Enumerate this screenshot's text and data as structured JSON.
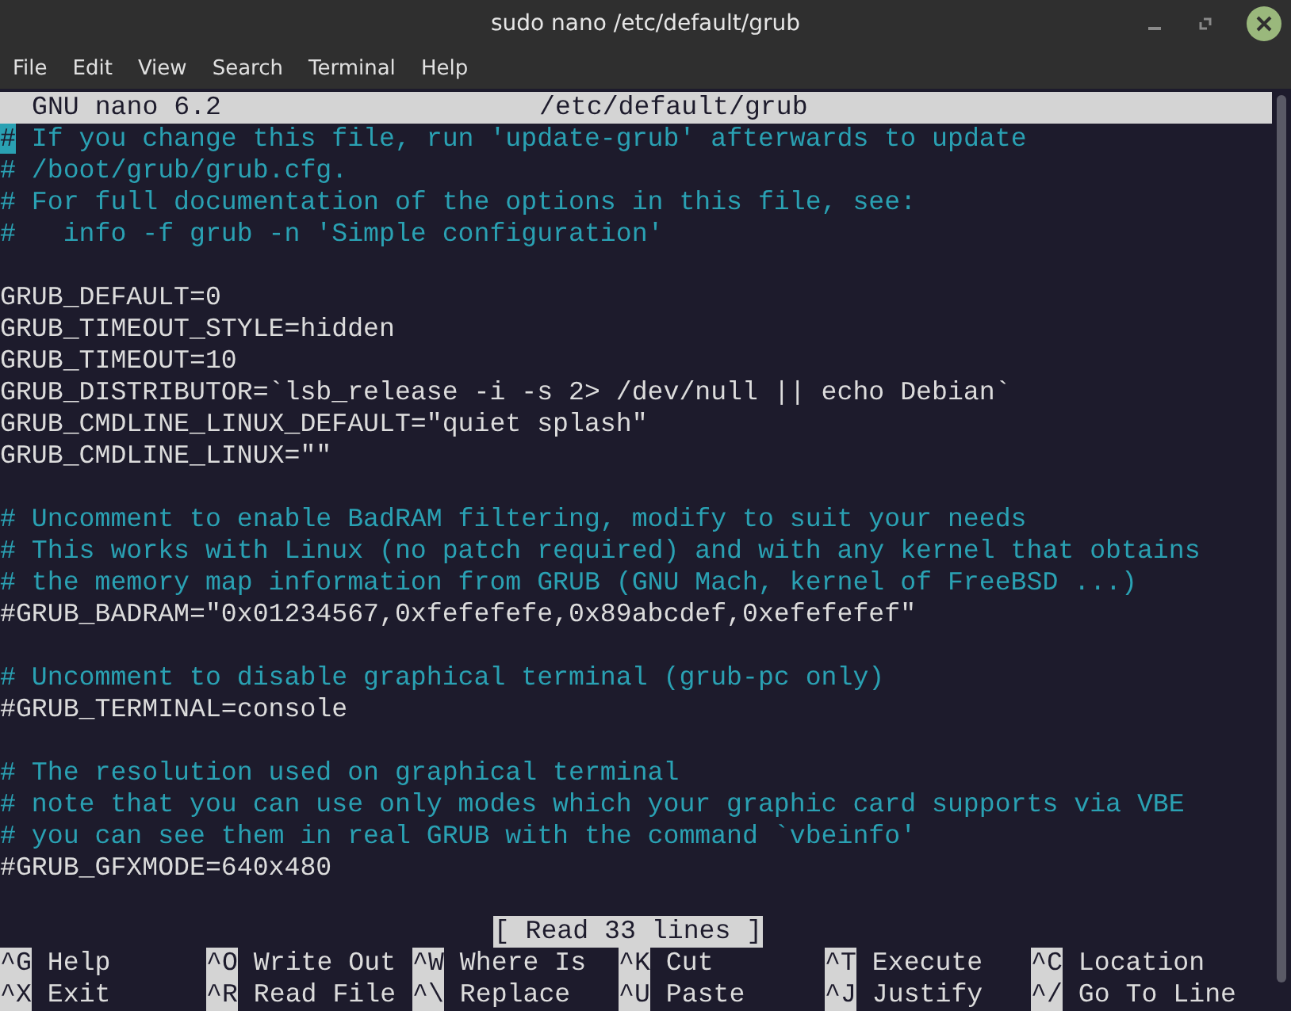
{
  "window": {
    "title": "sudo nano /etc/default/grub"
  },
  "menu": [
    "File",
    "Edit",
    "View",
    "Search",
    "Terminal",
    "Help"
  ],
  "header": {
    "version": "GNU nano 6.2",
    "file": "/etc/default/grub"
  },
  "lines": [
    {
      "kind": "comment",
      "text": "# If you change this file, run 'update-grub' afterwards to update",
      "cursor": true
    },
    {
      "kind": "comment",
      "text": "# /boot/grub/grub.cfg.",
      "cursor": false
    },
    {
      "kind": "comment",
      "text": "# For full documentation of the options in this file, see:",
      "cursor": false
    },
    {
      "kind": "comment",
      "text": "#   info -f grub -n 'Simple configuration'",
      "cursor": false
    },
    {
      "kind": "blank"
    },
    {
      "kind": "code",
      "text": "GRUB_DEFAULT=0",
      "cursor": false
    },
    {
      "kind": "code",
      "text": "GRUB_TIMEOUT_STYLE=hidden",
      "cursor": false
    },
    {
      "kind": "code",
      "text": "GRUB_TIMEOUT=10",
      "cursor": false
    },
    {
      "kind": "code",
      "text": "GRUB_DISTRIBUTOR=`lsb_release -i -s 2> /dev/null || echo Debian`",
      "cursor": false
    },
    {
      "kind": "code",
      "text": "GRUB_CMDLINE_LINUX_DEFAULT=\"quiet splash\"",
      "cursor": false
    },
    {
      "kind": "code",
      "text": "GRUB_CMDLINE_LINUX=\"\"",
      "cursor": false
    },
    {
      "kind": "blank"
    },
    {
      "kind": "comment",
      "text": "# Uncomment to enable BadRAM filtering, modify to suit your needs",
      "cursor": false
    },
    {
      "kind": "comment",
      "text": "# This works with Linux (no patch required) and with any kernel that obtains",
      "cursor": false
    },
    {
      "kind": "comment",
      "text": "# the memory map information from GRUB (GNU Mach, kernel of FreeBSD ...)",
      "cursor": false
    },
    {
      "kind": "code",
      "text": "#GRUB_BADRAM=\"0x01234567,0xfefefefe,0x89abcdef,0xefefefef\"",
      "cursor": false
    },
    {
      "kind": "blank"
    },
    {
      "kind": "comment",
      "text": "# Uncomment to disable graphical terminal (grub-pc only)",
      "cursor": false
    },
    {
      "kind": "code",
      "text": "#GRUB_TERMINAL=console",
      "cursor": false
    },
    {
      "kind": "blank"
    },
    {
      "kind": "comment",
      "text": "# The resolution used on graphical terminal",
      "cursor": false
    },
    {
      "kind": "comment",
      "text": "# note that you can use only modes which your graphic card supports via VBE",
      "cursor": false
    },
    {
      "kind": "comment",
      "text": "# you can see them in real GRUB with the command `vbeinfo'",
      "cursor": false
    },
    {
      "kind": "code",
      "text": "#GRUB_GFXMODE=640x480",
      "cursor": false
    }
  ],
  "status": "[ Read 33 lines ]",
  "shortcuts": [
    [
      {
        "key": "^G",
        "label": "Help"
      },
      {
        "key": "^O",
        "label": "Write Out"
      },
      {
        "key": "^W",
        "label": "Where Is"
      },
      {
        "key": "^K",
        "label": "Cut"
      },
      {
        "key": "^T",
        "label": "Execute"
      },
      {
        "key": "^C",
        "label": "Location"
      }
    ],
    [
      {
        "key": "^X",
        "label": "Exit"
      },
      {
        "key": "^R",
        "label": "Read File"
      },
      {
        "key": "^\\",
        "label": "Replace"
      },
      {
        "key": "^U",
        "label": "Paste"
      },
      {
        "key": "^J",
        "label": "Justify"
      },
      {
        "key": "^/",
        "label": "Go To Line"
      }
    ]
  ]
}
